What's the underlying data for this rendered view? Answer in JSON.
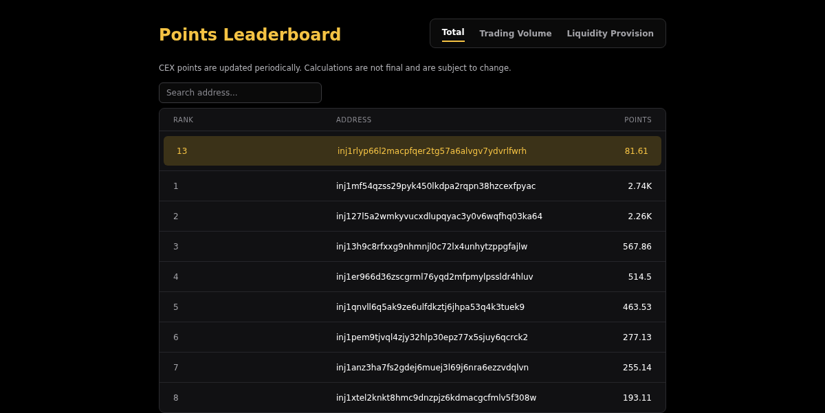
{
  "title": "Points Leaderboard",
  "tabs": [
    {
      "label": "Total",
      "selected": true
    },
    {
      "label": "Trading Volume",
      "selected": false
    },
    {
      "label": "Liquidity Provision",
      "selected": false
    }
  ],
  "notice": "CEX points are updated periodically. Calculations are not final and are subject to change.",
  "search": {
    "placeholder": "Search address..."
  },
  "table": {
    "columns": [
      "RANK",
      "ADDRESS",
      "POINTS"
    ],
    "rows": [
      {
        "rank": "13",
        "address": "inj1rlyp66l2macpfqer2tg57a6alvgv7ydvrlfwrh",
        "points": "81.61",
        "highlighted": true
      },
      {
        "rank": "1",
        "address": "inj1mf54qzss29pyk450lkdpa2rqpn38hzcexfpyac",
        "points": "2.74K",
        "highlighted": false
      },
      {
        "rank": "2",
        "address": "inj127l5a2wmkyvucxdlupqyac3y0v6wqfhq03ka64",
        "points": "2.26K",
        "highlighted": false
      },
      {
        "rank": "3",
        "address": "inj13h9c8rfxxg9nhmnjl0c72lx4unhytzppgfajlw",
        "points": "567.86",
        "highlighted": false
      },
      {
        "rank": "4",
        "address": "inj1er966d36zscgrml76yqd2mfpmylpssldr4hluv",
        "points": "514.5",
        "highlighted": false
      },
      {
        "rank": "5",
        "address": "inj1qnvll6q5ak9ze6ulfdkztj6jhpa53q4k3tuek9",
        "points": "463.53",
        "highlighted": false
      },
      {
        "rank": "6",
        "address": "inj1pem9tjvql4zjy32hlp30epz77x5sjuy6qcrck2",
        "points": "277.13",
        "highlighted": false
      },
      {
        "rank": "7",
        "address": "inj1anz3ha7fs2gdej6muej3l69j6nra6ezzvdqlvn",
        "points": "255.14",
        "highlighted": false
      },
      {
        "rank": "8",
        "address": "inj1xtel2knkt8hmc9dnzpjz6kdmacgcfmlv5f308w",
        "points": "193.11",
        "highlighted": false
      }
    ]
  }
}
